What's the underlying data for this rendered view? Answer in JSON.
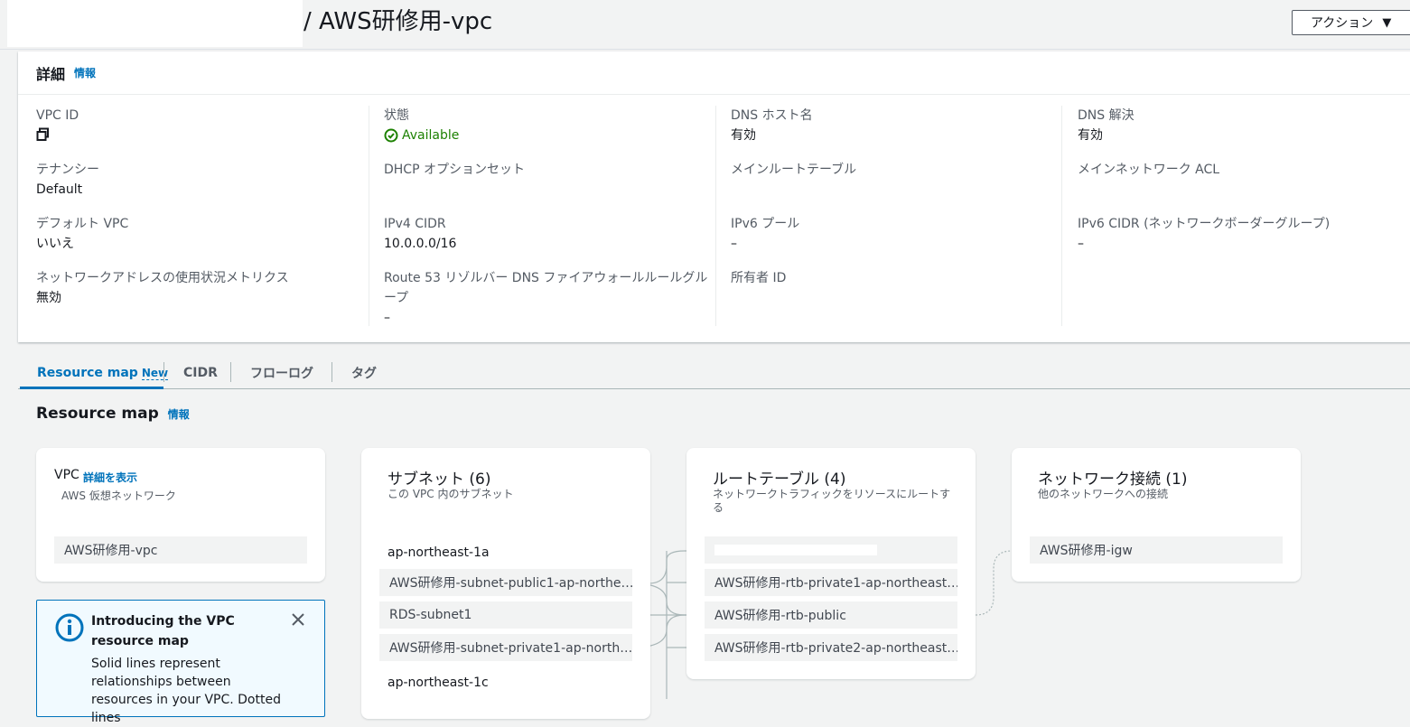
{
  "header": {
    "title": "/ AWS研修用-vpc",
    "actions_label": "アクション",
    "actions_caret": "▼"
  },
  "details": {
    "title": "詳細",
    "info": "情報",
    "fields": {
      "vpc_id_label": "VPC ID",
      "state_label": "状態",
      "state_value": "Available",
      "dns_hostname_label": "DNS ホスト名",
      "dns_hostname_value": "有効",
      "dns_resolution_label": "DNS 解決",
      "dns_resolution_value": "有効",
      "tenancy_label": "テナンシー",
      "tenancy_value": "Default",
      "dhcp_label": "DHCP オプションセット",
      "main_rt_label": "メインルートテーブル",
      "main_acl_label": "メインネットワーク ACL",
      "default_vpc_label": "デフォルト VPC",
      "default_vpc_value": "いいえ",
      "ipv4_label": "IPv4 CIDR",
      "ipv4_value": "10.0.0.0/16",
      "ipv6_pool_label": "IPv6 プール",
      "ipv6_pool_value": "–",
      "ipv6_cidr_label": "IPv6 CIDR (ネットワークボーダーグループ)",
      "ipv6_cidr_value": "–",
      "metrics_label": "ネットワークアドレスの使用状況メトリクス",
      "metrics_value": "無効",
      "route53_label": "Route 53 リゾルバー DNS ファイアウォールルールグループ",
      "route53_value": "–",
      "owner_label": "所有者 ID"
    }
  },
  "tabs": {
    "resource_map": "Resource map",
    "new_badge": "New",
    "cidr": "CIDR",
    "flowlog": "フローログ",
    "tags": "タグ"
  },
  "resource_map": {
    "title": "Resource map",
    "info": "情報",
    "vpc_card": {
      "title": "VPC",
      "details_link": "詳細を表示",
      "subtitle": "AWS 仮想ネットワーク",
      "item": "AWS研修用-vpc"
    },
    "subnet_card": {
      "title": "サブネット (6)",
      "subtitle": "この VPC 内のサブネット",
      "az1": "ap-northeast-1a",
      "items": [
        "AWS研修用-subnet-public1-ap-northe…",
        "RDS-subnet1",
        "AWS研修用-subnet-private1-ap-north…"
      ],
      "az2": "ap-northeast-1c"
    },
    "rt_card": {
      "title": "ルートテーブル (4)",
      "subtitle": "ネットワークトラフィックをリソースにルートする",
      "items": [
        "AWS研修用-rtb-private1-ap-northeast…",
        "AWS研修用-rtb-public",
        "AWS研修用-rtb-private2-ap-northeast…"
      ]
    },
    "net_card": {
      "title": "ネットワーク接続 (1)",
      "subtitle": "他のネットワークへの接続",
      "item": "AWS研修用-igw"
    },
    "intro": {
      "title": "Introducing the VPC resource map",
      "body": "Solid lines represent relationships between resources in your VPC. Dotted lines"
    }
  },
  "colors": {
    "link": "#0073bb",
    "success": "#1d8102",
    "chip_bg": "#f2f3f3"
  }
}
